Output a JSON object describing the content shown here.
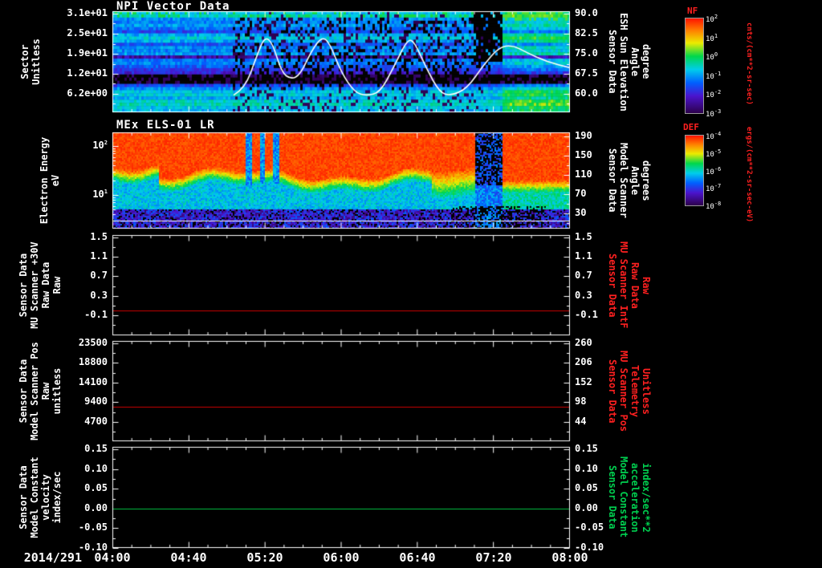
{
  "x_axis": {
    "date": "2014/291",
    "ticks": [
      "04:00",
      "04:40",
      "05:20",
      "06:00",
      "06:40",
      "07:20",
      "08:00"
    ]
  },
  "chart_data": [
    {
      "type": "spectrogram",
      "title": "NPI Vector Data",
      "y_axis": {
        "label_lines": [
          "Sector",
          "Unitless"
        ],
        "ticks": [
          "3.1e+01",
          "2.5e+01",
          "1.9e+01",
          "1.2e+01",
          "6.2e+00"
        ],
        "scale": "linear"
      },
      "y2_axis": {
        "label_lines": [
          "Sensor Data",
          "ESH Sun Elevation",
          "Angle",
          "degree"
        ],
        "ticks": [
          "90.0",
          "82.5",
          "75.0",
          "67.5",
          "60.0"
        ],
        "color": "#ffffff"
      },
      "colorbar": {
        "title": "NF",
        "units": "cnts/(cm**2-sr-sec)",
        "tick_exponents": [
          2,
          1,
          0,
          -1,
          -2,
          -3
        ]
      },
      "overlay_line": {
        "name": "sun-elevation-angle-deg",
        "color": "#ffffff",
        "points": [
          [
            0.265,
            59.5
          ],
          [
            0.29,
            62
          ],
          [
            0.315,
            74
          ],
          [
            0.333,
            81.5
          ],
          [
            0.35,
            79
          ],
          [
            0.37,
            68
          ],
          [
            0.39,
            65.5
          ],
          [
            0.41,
            67
          ],
          [
            0.435,
            76
          ],
          [
            0.458,
            81.5
          ],
          [
            0.475,
            79
          ],
          [
            0.5,
            68
          ],
          [
            0.53,
            60.5
          ],
          [
            0.555,
            59.3
          ],
          [
            0.585,
            60.5
          ],
          [
            0.615,
            70
          ],
          [
            0.645,
            80.5
          ],
          [
            0.66,
            79.5
          ],
          [
            0.685,
            70
          ],
          [
            0.715,
            60.5
          ],
          [
            0.74,
            59.3
          ],
          [
            0.775,
            62
          ],
          [
            0.81,
            70.5
          ],
          [
            0.845,
            77.5
          ],
          [
            0.875,
            78.2
          ],
          [
            0.905,
            75.5
          ],
          [
            0.95,
            72
          ],
          [
            1.0,
            69.8
          ]
        ]
      },
      "texture": {
        "row_base": [
          0.5,
          0.55,
          0.42,
          0.4,
          0.44,
          0.38,
          0.3,
          0.46,
          0.52,
          0.46,
          0.32,
          0.42,
          0.4,
          0.44,
          0.15,
          0.38,
          0.4,
          0.34,
          0.28,
          0.22,
          0.03,
          0.02,
          0.03,
          0.3,
          0.42,
          0.5,
          0.52,
          0.46,
          0.54,
          0.56,
          0.5,
          0.48
        ],
        "speckle_t_range": [
          0.26,
          0.83
        ],
        "dark_notch_t_range": [
          0.79,
          0.855
        ],
        "bright_from_t": 0.855
      }
    },
    {
      "type": "spectrogram",
      "title": "MEx ELS-01 LR",
      "y_axis": {
        "label_lines": [
          "Electron Energy",
          "eV"
        ],
        "tick_exponents": [
          2,
          1
        ],
        "scale": "log"
      },
      "y2_axis": {
        "label_lines": [
          "Sensor Data",
          "Model Scanner",
          "Angle",
          "degrees"
        ],
        "ticks": [
          "190",
          "150",
          "110",
          "70",
          "30"
        ],
        "color": "#ffffff"
      },
      "colorbar": {
        "title": "DEF",
        "units": "ergs/(cm**2-sr-sec-eV)",
        "tick_exponents": [
          -4,
          -5,
          -6,
          -7,
          -8
        ]
      },
      "texture": {
        "red_value": 0.94,
        "boundary_base": 0.43,
        "transition": 0.14,
        "dropout_stripes_t": [
          0.298,
          0.328,
          0.358
        ],
        "disturbance_t_range": [
          0.795,
          0.855
        ],
        "wide_transition_t_range": [
          0.7,
          0.795
        ],
        "white_line_yfrac": 0.92,
        "bottom_dark_yfrac": 0.8
      }
    },
    {
      "type": "line",
      "y_axis": {
        "label_lines": [
          "Sensor Data",
          "MU Scanner +30V",
          "Raw Data",
          "Raw"
        ],
        "ticks": [
          "1.5",
          "1.1",
          "0.7",
          "0.3",
          "-0.1"
        ]
      },
      "y2_axis": {
        "label_lines": [
          "Sensor Data",
          "MU Scanner IntF",
          "Raw Data",
          "Raw"
        ],
        "ticks": [
          "1.5",
          "1.1",
          "0.7",
          "0.3",
          "-0.1"
        ],
        "color": "#ff2020"
      },
      "series": [
        {
          "name": "MU Scanner IntF Raw",
          "color": "#cc0000",
          "constant_value": 0.0
        }
      ]
    },
    {
      "type": "line",
      "y_axis": {
        "label_lines": [
          "Sensor Data",
          "Model Scanner Pos",
          "Raw",
          "unitless"
        ],
        "ticks": [
          "23500",
          "18800",
          "14100",
          "9400",
          "4700"
        ]
      },
      "y2_axis": {
        "label_lines": [
          "Sensor Data",
          "MU Scanner Pos",
          "Telemetry",
          "Unitless"
        ],
        "ticks": [
          "260",
          "206",
          "152",
          "98",
          "44"
        ],
        "color": "#ff2020"
      },
      "series": [
        {
          "name": "MU Scanner Pos Telemetry",
          "color": "#cc0000",
          "constant_value": 8300
        }
      ]
    },
    {
      "type": "line",
      "y_axis": {
        "label_lines": [
          "Sensor Data",
          "Model Constant",
          "velocity",
          "index/sec"
        ],
        "ticks": [
          "0.15",
          "0.10",
          "0.05",
          "0.00",
          "-0.05",
          "-0.10"
        ]
      },
      "y2_axis": {
        "label_lines": [
          "Sensor Data",
          "Model Constant",
          "acceleration",
          "index/sec**2"
        ],
        "ticks": [
          "0.15",
          "0.10",
          "0.05",
          "0.00",
          "-0.05",
          "-0.10"
        ],
        "color": "#00d050"
      },
      "series": [
        {
          "name": "Model Constant velocity",
          "color": "#00c040",
          "constant_value": 0.0
        }
      ]
    }
  ]
}
